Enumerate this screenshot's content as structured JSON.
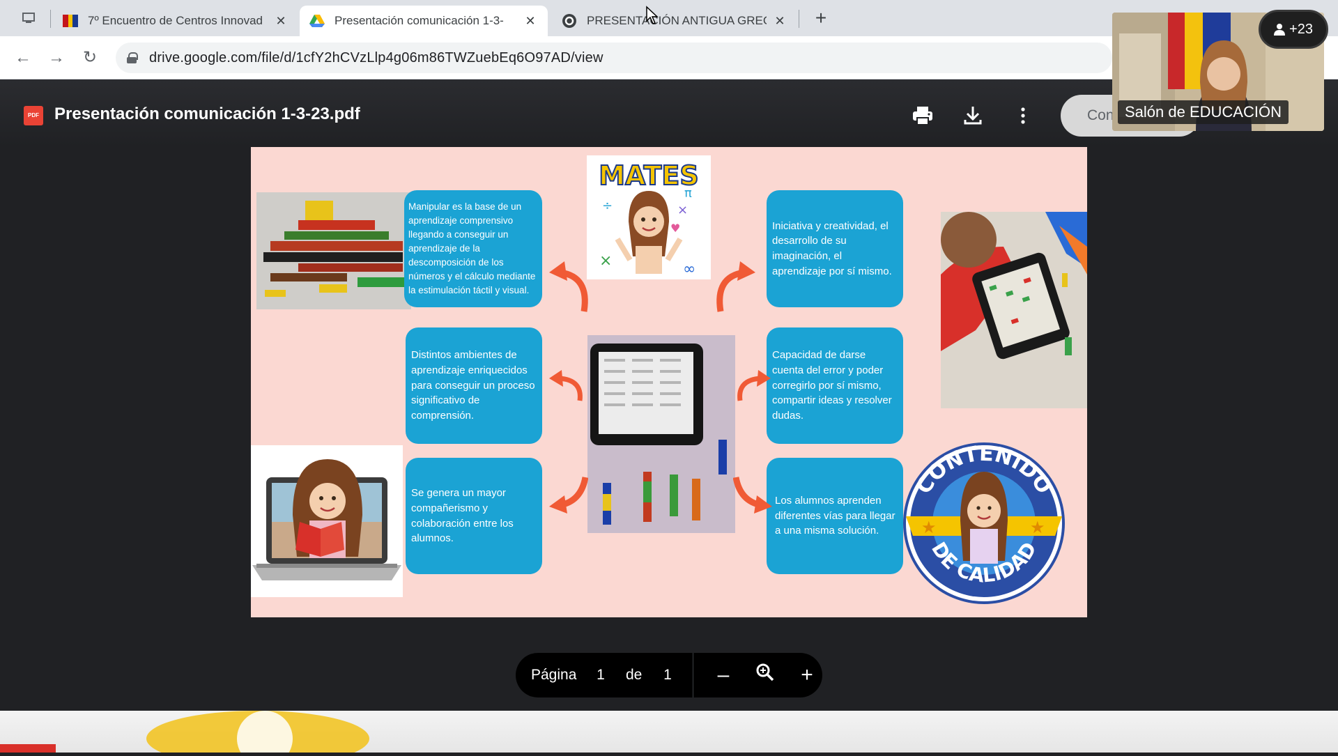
{
  "browser": {
    "tabs": [
      {
        "title": "7º Encuentro de Centros Innovad",
        "active": false
      },
      {
        "title": "Presentación comunicación 1-3-",
        "active": true
      },
      {
        "title": "PRESENTACIÓN ANTIGUA GRECIA",
        "active": false
      }
    ],
    "url": "drive.google.com/file/d/1cfY2hCVzLlp4g06m86TWZuebEq6O97AD/view"
  },
  "viewer": {
    "doc_title": "Presentación comunicación 1-3-23.pdf",
    "open_with_label": "Con",
    "icons": [
      "print-icon",
      "download-icon",
      "more-vert-icon"
    ]
  },
  "slide": {
    "mates_title": "MATES",
    "badge_top": "CONTENIDO",
    "badge_bottom": "DE CALIDAD",
    "cards": [
      "Manipular es la base de un aprendizaje comprensivo llegando a conseguir un aprendizaje de la descomposición de los números y el cálculo mediante la estimulación táctil y visual.",
      "Distintos ambientes de aprendizaje enriquecidos para conseguir un proceso significativo de comprensión.",
      "Se genera un mayor compañerismo y colaboración entre los alumnos.",
      "Iniciativa y creatividad, el desarrollo de su imaginación, el aprendizaje por sí mismo.",
      "Capacidad de darse cuenta del error y poder corregirlo por sí mismo, compartir ideas y resolver dudas.",
      "Los alumnos aprenden diferentes vías para llegar a una misma solución."
    ]
  },
  "pager": {
    "page_label": "Página",
    "current_page": "1",
    "of_label": "de",
    "total_pages": "1"
  },
  "video": {
    "participant_name": "Salón de EDUCACIÓN",
    "participants_count": "+23"
  },
  "colors": {
    "card": "#1ba3d4",
    "slide_bg": "#fbd8d2",
    "arrow": "#f05a35"
  }
}
